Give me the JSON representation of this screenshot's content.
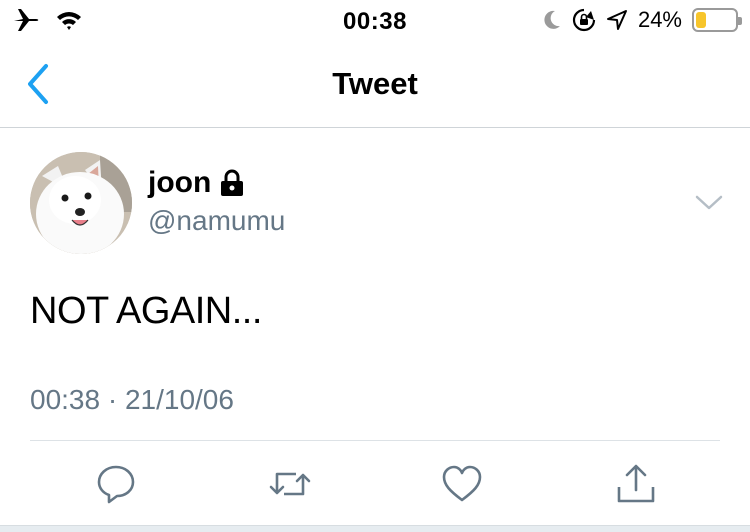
{
  "status_bar": {
    "time": "00:38",
    "battery_percent": "24%",
    "battery_level": 0.24,
    "icons": [
      "airplane-icon",
      "wifi-icon",
      "moon-icon",
      "rotation-lock-icon",
      "location-icon",
      "battery-icon"
    ],
    "battery_color": "#f7c52b"
  },
  "nav": {
    "title": "Tweet",
    "back_icon": "chevron-left-icon",
    "accent_color": "#1da1f2"
  },
  "tweet": {
    "user": {
      "name": "joon",
      "handle": "@namumu",
      "protected_icon": "lock-icon"
    },
    "text": "NOT AGAIN...",
    "timestamp": "00:38 · 21/10/06"
  },
  "actions": [
    "reply-icon",
    "retweet-icon",
    "like-icon",
    "share-icon"
  ]
}
